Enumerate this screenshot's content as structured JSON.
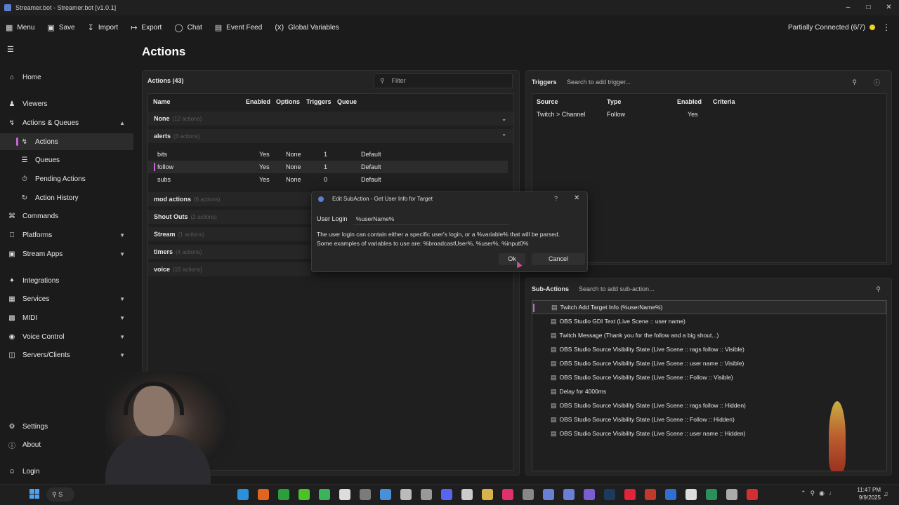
{
  "window": {
    "title": "Streamer.bot - Streamer.bot [v1.0.1]",
    "controls": [
      "minimize-icon",
      "maximize-icon",
      "close-icon"
    ]
  },
  "menubar": {
    "items": [
      {
        "label": "Menu",
        "icon": "grid-icon"
      },
      {
        "label": "Save",
        "icon": "save-icon"
      },
      {
        "label": "Import",
        "icon": "import-icon"
      },
      {
        "label": "Export",
        "icon": "export-icon"
      },
      {
        "label": "Chat",
        "icon": "chat-icon"
      },
      {
        "label": "Event Feed",
        "icon": "feed-icon"
      },
      {
        "label": "Global Variables",
        "icon": "variable-icon"
      }
    ],
    "status": "Partially Connected (6/7)",
    "status_color": "#f1d21f"
  },
  "sidebar": {
    "items": [
      {
        "label": "Home",
        "icon": "home-icon"
      },
      {
        "label": "Viewers",
        "icon": "users-icon"
      },
      {
        "label": "Actions & Queues",
        "icon": "bolt-icon",
        "expanded": true
      },
      {
        "label": "Actions",
        "icon": "action-icon",
        "active": true
      },
      {
        "label": "Queues",
        "icon": "queue-icon"
      },
      {
        "label": "Pending Actions",
        "icon": "pending-icon"
      },
      {
        "label": "Action History",
        "icon": "history-icon"
      },
      {
        "label": "Commands",
        "icon": "command-icon"
      },
      {
        "label": "Platforms",
        "icon": "platform-icon"
      },
      {
        "label": "Stream Apps",
        "icon": "apps-icon"
      },
      {
        "label": "Integrations",
        "icon": "integration-icon"
      },
      {
        "label": "Services",
        "icon": "services-icon"
      },
      {
        "label": "MIDI",
        "icon": "midi-icon"
      },
      {
        "label": "Voice Control",
        "icon": "mic-icon"
      },
      {
        "label": "Servers/Clients",
        "icon": "server-icon"
      },
      {
        "label": "Settings",
        "icon": "gear-icon"
      },
      {
        "label": "About",
        "icon": "info-icon"
      },
      {
        "label": "Login",
        "icon": "user-icon"
      }
    ]
  },
  "page": {
    "title": "Actions"
  },
  "actions": {
    "header": "Actions (43)",
    "filter_placeholder": "Filter",
    "columns": [
      "Name",
      "Enabled",
      "Options",
      "Triggers",
      "Queue"
    ],
    "groups": [
      {
        "name": "None",
        "count": "(12 actions)"
      },
      {
        "name": "alerts",
        "count": "(3 actions)"
      },
      {
        "name": "mod actions",
        "count": "(6 actions)"
      },
      {
        "name": "Shout Outs",
        "count": "(2 actions)"
      },
      {
        "name": "Stream",
        "count": "(1 actions)"
      },
      {
        "name": "timers",
        "count": "(4 actions)"
      },
      {
        "name": "voice",
        "count": "(15 actions)"
      }
    ],
    "rows": [
      {
        "name": "bits",
        "enabled": "Yes",
        "options": "None",
        "triggers": "1",
        "queue": "Default"
      },
      {
        "name": "follow",
        "enabled": "Yes",
        "options": "None",
        "triggers": "1",
        "queue": "Default"
      },
      {
        "name": "subs",
        "enabled": "Yes",
        "options": "None",
        "triggers": "0",
        "queue": "Default"
      }
    ]
  },
  "triggers": {
    "header": "Triggers",
    "search_placeholder": "Search to add trigger...",
    "columns": [
      "Source",
      "Type",
      "Enabled",
      "Criteria"
    ],
    "rows": [
      {
        "source": "Twitch > Channel",
        "type": "Follow",
        "enabled": "Yes",
        "criteria": ""
      }
    ]
  },
  "subactions": {
    "header": "Sub-Actions",
    "search_placeholder": "Search to add sub-action...",
    "items": [
      "Twitch Add Target Info (%userName%)",
      "OBS Studio GDI Text (Live Scene :: user name)",
      "Twitch Message (Thank you for the follow and a big shout...)",
      "OBS Studio Source Visibility State (Live Scene :: rags follow :: Visible)",
      "OBS Studio Source Visibility State (Live Scene :: user name :: Visible)",
      "OBS Studio Source Visibility State (Live Scene :: Follow :: Visible)",
      "Delay for 4000ms",
      "OBS Studio Source Visibility State (Live Scene :: rags follow :: Hidden)",
      "OBS Studio Source Visibility State (Live Scene :: Follow :: Hidden)",
      "OBS Studio Source Visibility State (Live Scene :: user name :: Hidden)"
    ]
  },
  "dialog": {
    "title": "Edit SubAction - Get User Info for Target",
    "help": "?",
    "close": "✕",
    "field_label": "User Login",
    "field_value": "%userName%",
    "hint_line1": "The user login can contain either a specific user's login, or a %variable% that will be parsed.",
    "hint_line2": "Some examples of variables to use are: %broadcastUser%, %user%, %input0%",
    "ok": "Ok",
    "cancel": "Cancel"
  },
  "taskbar": {
    "search": "S",
    "time": "11:47 PM",
    "date": "9/9/2025"
  }
}
